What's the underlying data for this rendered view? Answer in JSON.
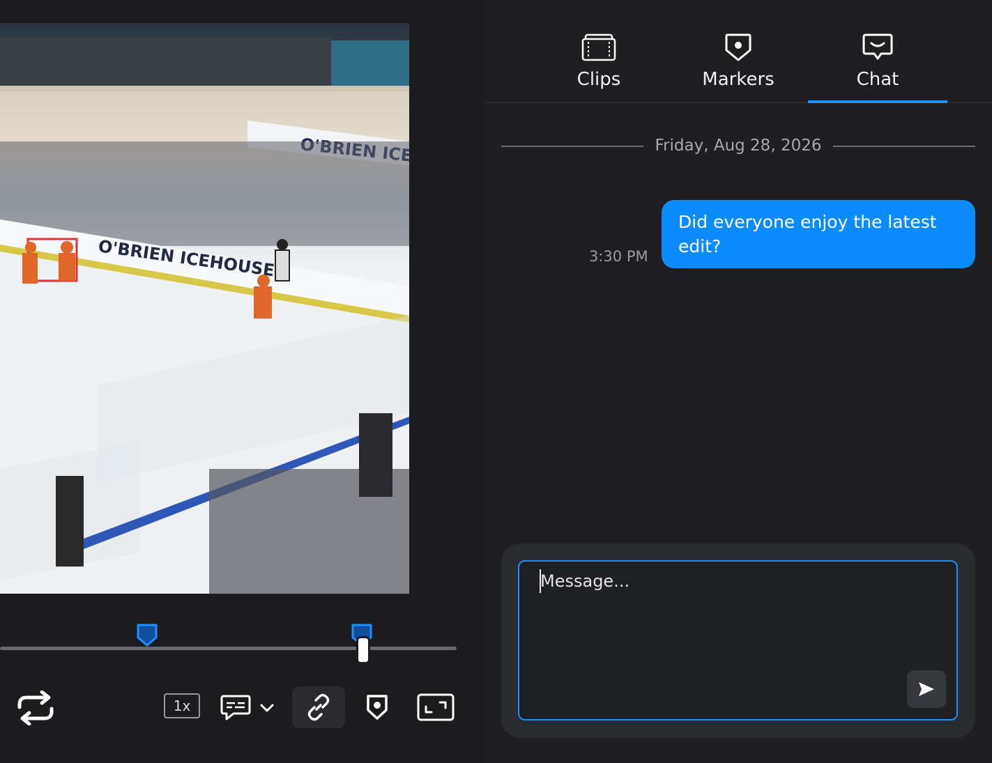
{
  "player": {
    "speed_label": "1x",
    "video_description": "ice hockey game broadcast frame"
  },
  "tabs": [
    {
      "label": "Clips",
      "icon": "clips-icon",
      "active": false
    },
    {
      "label": "Markers",
      "icon": "marker-icon",
      "active": false
    },
    {
      "label": "Chat",
      "icon": "chat-icon",
      "active": true
    }
  ],
  "chat": {
    "date_separator": "Friday, Aug 28, 2026",
    "messages": [
      {
        "time": "3:30 PM",
        "text": "Did everyone enjoy the latest edit?"
      }
    ],
    "composer": {
      "placeholder": "Message...",
      "value": ""
    }
  },
  "colors": {
    "accent": "#1e8fff",
    "bubble": "#0a8cff",
    "background": "#1c1c1f",
    "panel": "#1f1f22"
  }
}
